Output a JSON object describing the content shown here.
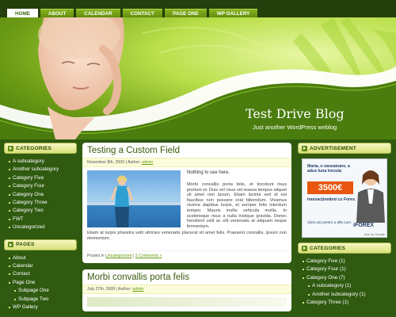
{
  "nav": {
    "items": [
      {
        "label": "HOME",
        "active": true
      },
      {
        "label": "ABOUT",
        "active": false
      },
      {
        "label": "CALENDAR",
        "active": false
      },
      {
        "label": "CONTACT",
        "active": false
      },
      {
        "label": "PAGE ONE",
        "active": false
      },
      {
        "label": "WP GALLERY",
        "active": false
      }
    ]
  },
  "header": {
    "title": "Test Drive Blog",
    "tagline": "Just another WordPress weblog"
  },
  "left_sidebar": {
    "categories_title": "CATEGORIES",
    "categories": [
      {
        "label": "A subcategory",
        "sub": false
      },
      {
        "label": "Another subcategory",
        "sub": false
      },
      {
        "label": "Category Five",
        "sub": false
      },
      {
        "label": "Category Four",
        "sub": false
      },
      {
        "label": "Category One",
        "sub": false
      },
      {
        "label": "Category Three",
        "sub": false
      },
      {
        "label": "Category Two",
        "sub": false
      },
      {
        "label": "FWT",
        "sub": false
      },
      {
        "label": "Uncategorized",
        "sub": false
      }
    ],
    "pages_title": "PAGES",
    "pages": [
      {
        "label": "About",
        "sub": false
      },
      {
        "label": "Calendar",
        "sub": false
      },
      {
        "label": "Contact",
        "sub": false
      },
      {
        "label": "Page One",
        "sub": false
      },
      {
        "label": "Subpage One",
        "sub": true
      },
      {
        "label": "Subpage Two",
        "sub": true
      },
      {
        "label": "WP Gallery",
        "sub": false
      }
    ]
  },
  "posts": [
    {
      "title": "Testing a Custom Field",
      "meta_prefix": "November 8th, 2009 | Author: ",
      "author": "admin",
      "lead": "Nothing to see here.",
      "para1": "Morbi convallis porta felis, et tincidunt risus pretium et. Duis vel risus vel massa tempus aliquet sit amet non ipsum. Etiam lacinia sed id est faucibus non posuere erat bibendum. Vivamus viverra dapibus turpis, et semper felis interdum tempor. Mauris mollis vehicula mollis. In scelerisque risus a nulla tristique gravida. Donec hendrerit velit ac elit venenatis at aliquam neque fermentum.",
      "para2": "Etiam at turpis pharetra velit ultricies venenatis placerat sit amet felis. Praesent convallis, ipsum non elementum.",
      "footer_prefix": "Posted in ",
      "category": "Uncategorized",
      "separator": " | ",
      "comments": "2 Comments »"
    },
    {
      "title": "Morbi convallis porta felis",
      "meta_prefix": "July 27th, 2009 | Author: ",
      "author": "admin"
    }
  ],
  "right_sidebar": {
    "ad_title": "ADVERTISEMENT",
    "ad": {
      "text": "Maria, o vanzatoare, a adus luna trecuta",
      "price": "3500€",
      "sub": "tranzacţionând cu Forex.",
      "click": "Click aici pentru a afla cum.",
      "brand": "iFOREX",
      "footer": "Ads by Google"
    },
    "categories_title": "CATEGORIES",
    "categories": [
      {
        "label": "Category Five (1)",
        "sub": false
      },
      {
        "label": "Category Four (1)",
        "sub": false
      },
      {
        "label": "Category One (7)",
        "sub": false
      },
      {
        "label": "A subcategory (1)",
        "sub": true
      },
      {
        "label": "Another subcategory (1)",
        "sub": true
      },
      {
        "label": "Category Three (1)",
        "sub": false
      }
    ]
  },
  "colors": {
    "background": "#2f5a10",
    "nav_bar": "#243f0b",
    "tab": "#6f9c15",
    "widget_head": "#eef2a0",
    "link": "#6a9a12",
    "title_green": "#3a5a0e"
  }
}
